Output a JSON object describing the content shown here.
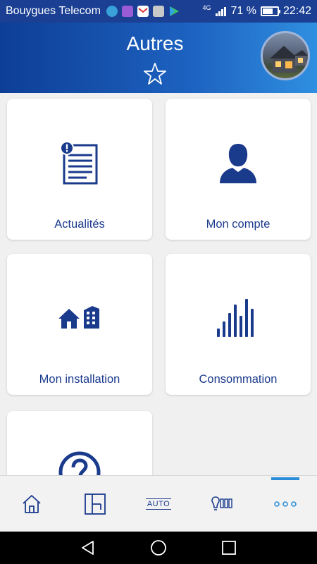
{
  "status_bar": {
    "carrier": "Bouygues Telecom",
    "network": "4G",
    "battery_percent": "71 %",
    "battery_level": 0.71,
    "time": "22:42"
  },
  "header": {
    "title": "Autres"
  },
  "tiles": [
    {
      "label": "Actualités",
      "icon": "news-icon"
    },
    {
      "label": "Mon compte",
      "icon": "user-icon"
    },
    {
      "label": "Mon installation",
      "icon": "installation-icon"
    },
    {
      "label": "Consommation",
      "icon": "consumption-icon"
    },
    {
      "label": "",
      "icon": "help-icon"
    }
  ],
  "bottom_nav": {
    "items": [
      {
        "name": "home",
        "icon": "home-icon"
      },
      {
        "name": "floor-plan",
        "icon": "floor-plan-icon"
      },
      {
        "name": "auto",
        "icon": "auto-icon",
        "label": "AUTO"
      },
      {
        "name": "lights",
        "icon": "lights-icon"
      },
      {
        "name": "more",
        "icon": "more-icon",
        "active": true
      }
    ]
  },
  "colors": {
    "brand": "#1a3a8c",
    "header_start": "#0d3e96",
    "header_end": "#2f8fe0",
    "active": "#2a8fd8"
  }
}
